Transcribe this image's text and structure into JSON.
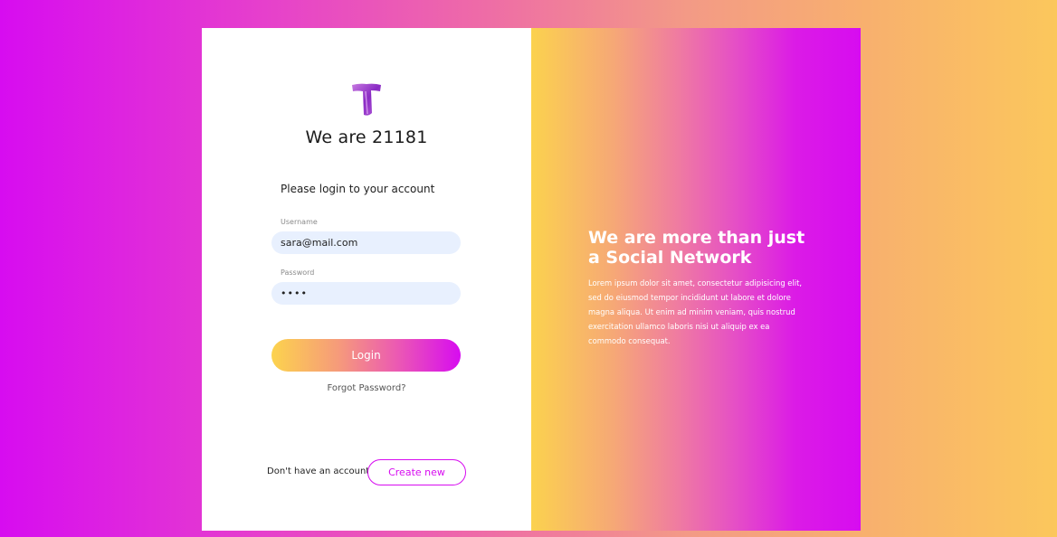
{
  "brand": {
    "logo_icon": "purple-t-logo-icon",
    "title": "We are 21181"
  },
  "login": {
    "prompt": "Please login to your account",
    "username_label": "Username",
    "username_value": "sara@mail.com",
    "password_label": "Password",
    "password_value": "1234",
    "login_label": "Login",
    "forgot_label": "Forgot Password?"
  },
  "signup": {
    "question": "Don't have an account?",
    "create_label": "Create new"
  },
  "promo": {
    "title": "We are more than just a Social Network",
    "text": "Lorem ipsum dolor sit amet, consectetur adipisicing elit, sed do eiusmod tempor incididunt ut labore et dolore magna aliqua. Ut enim ad minim veniam, quis nostrud exercitation ullamco laboris nisi ut aliquip ex ea commodo consequat."
  },
  "colors": {
    "accent_magenta": "#d70cf0",
    "accent_yellow": "#fcd34d",
    "input_bg": "#e8f0fe"
  }
}
